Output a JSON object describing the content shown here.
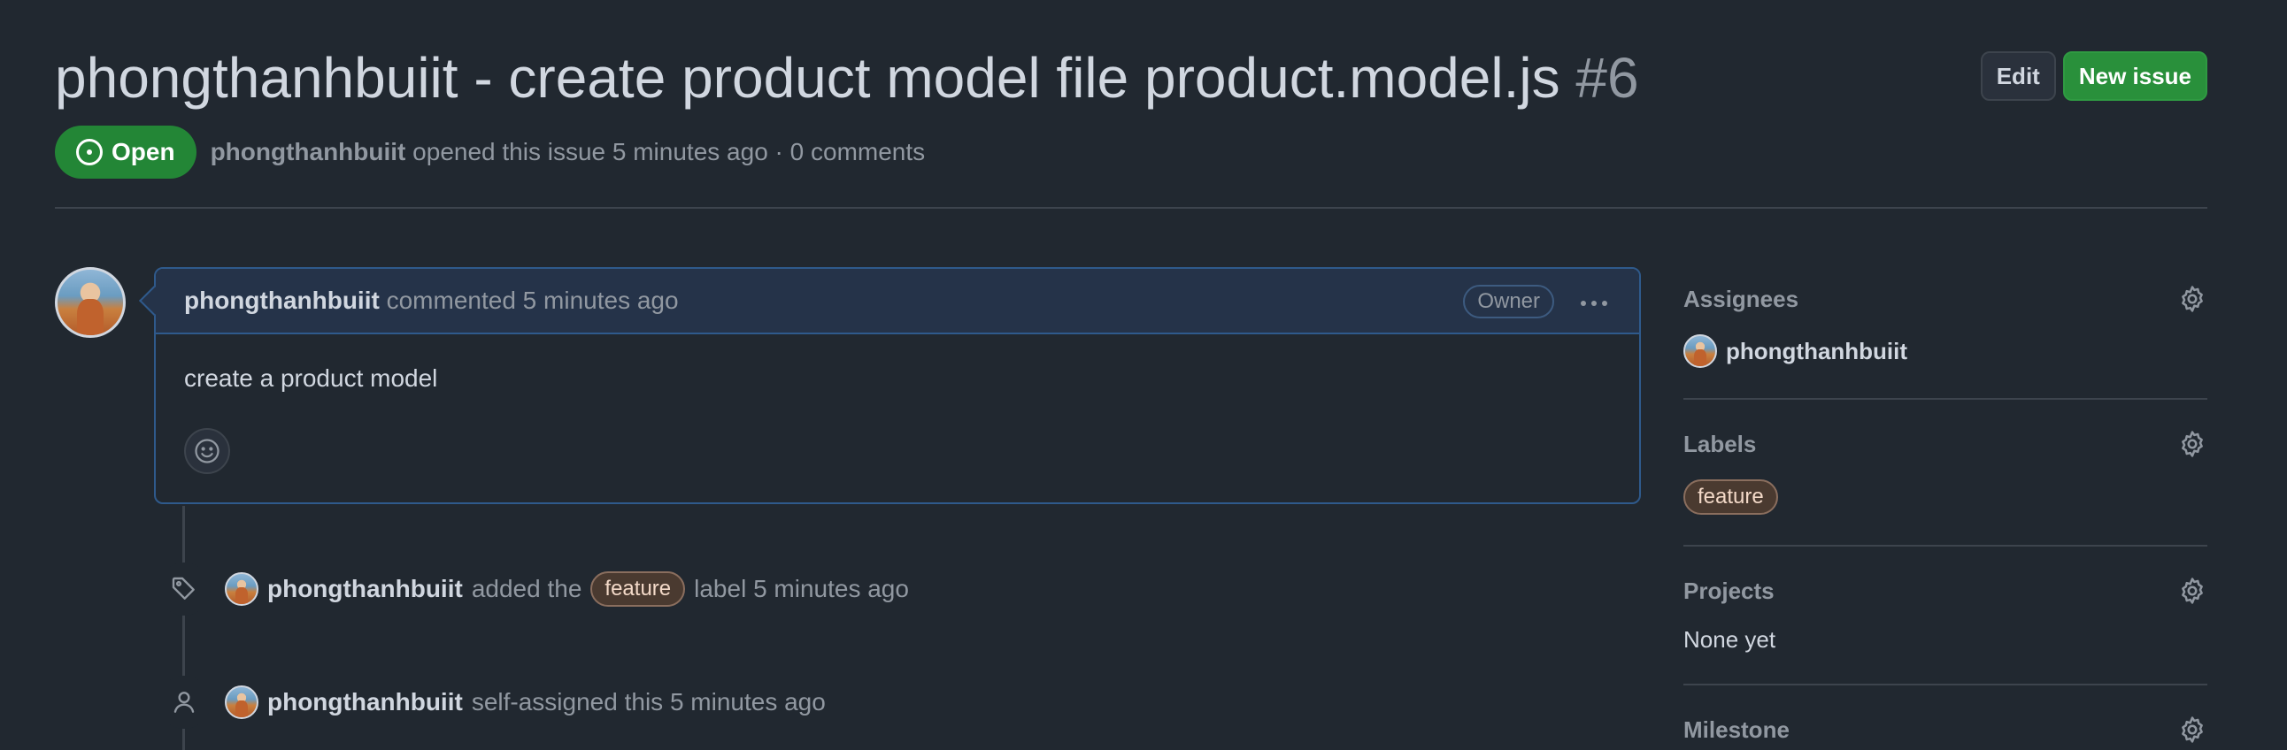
{
  "issue": {
    "title": "phongthanhbuiit - create product model file product.model.js",
    "number": "#6",
    "state": "Open",
    "author": "phongthanhbuiit",
    "meta_suffix": "opened this issue 5 minutes ago · 0 comments"
  },
  "header": {
    "edit_label": "Edit",
    "new_issue_label": "New issue"
  },
  "comment": {
    "author": "phongthanhbuiit",
    "action": "commented 5 minutes ago",
    "badge": "Owner",
    "body": "create a product model"
  },
  "timeline": [
    {
      "icon": "tag-icon",
      "actor": "phongthanhbuiit",
      "before": "added the",
      "label": "feature",
      "after": "label 5 minutes ago"
    },
    {
      "icon": "person-icon",
      "actor": "phongthanhbuiit",
      "text": "self-assigned this 5 minutes ago"
    }
  ],
  "sidebar": {
    "assignees": {
      "title": "Assignees",
      "value": "phongthanhbuiit"
    },
    "labels": {
      "title": "Labels",
      "value": "feature"
    },
    "projects": {
      "title": "Projects",
      "value": "None yet"
    },
    "milestone": {
      "title": "Milestone"
    }
  },
  "colors": {
    "background": "#212830",
    "open_green": "#238636",
    "comment_border": "#2f5a8c",
    "label_bg": "#4a3a30"
  }
}
